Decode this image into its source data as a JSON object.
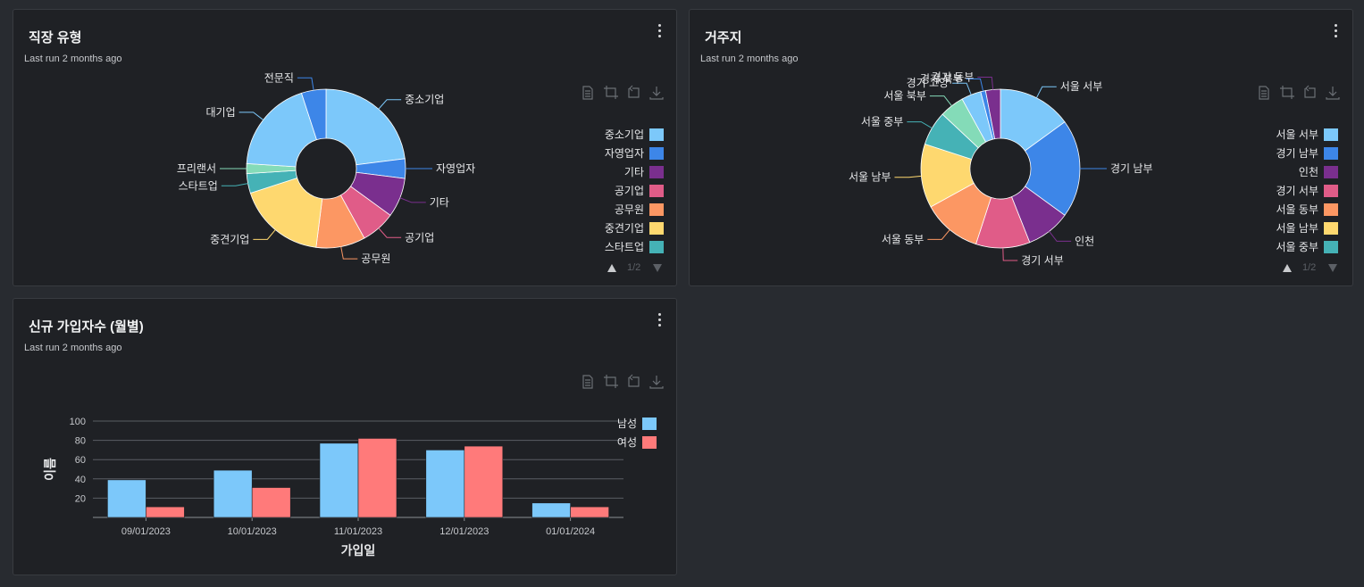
{
  "colors": {
    "background": "#282b30",
    "panel": "#1f2125",
    "light_blue": "#7cc8fa",
    "blue": "#3d86e8",
    "purple": "#7a2f8e",
    "pink": "#e05c88",
    "orange": "#fc9763",
    "yellow": "#fed86f",
    "teal": "#45b2b6",
    "mint": "#84dbb8",
    "salmon": "#ff7a7a"
  },
  "panels": [
    {
      "title": "직장 유형",
      "subtitle": "Last run 2 months ago",
      "pager": "1/2",
      "toolbox_icons": [
        "data-view-icon",
        "zoom-icon",
        "zoom-reset-icon",
        "download-icon"
      ],
      "chart_data": {
        "type": "pie",
        "title": "",
        "slices": [
          {
            "name": "중소기업",
            "value": 23,
            "color": "#7cc8fa"
          },
          {
            "name": "자영업자",
            "value": 4,
            "color": "#3d86e8"
          },
          {
            "name": "기타",
            "value": 8,
            "color": "#7a2f8e"
          },
          {
            "name": "공기업",
            "value": 7,
            "color": "#e05c88"
          },
          {
            "name": "공무원",
            "value": 10,
            "color": "#fc9763"
          },
          {
            "name": "중견기업",
            "value": 18,
            "color": "#fed86f"
          },
          {
            "name": "스타트업",
            "value": 4,
            "color": "#45b2b6"
          },
          {
            "name": "프리랜서",
            "value": 2,
            "color": "#84dbb8"
          },
          {
            "name": "대기업",
            "value": 19,
            "color": "#7cc8fa"
          },
          {
            "name": "전문직",
            "value": 5,
            "color": "#3d86e8"
          }
        ],
        "legend": {
          "placement": "right",
          "entries": [
            "중소기업",
            "자영업자",
            "기타",
            "공기업",
            "공무원",
            "중견기업",
            "스타트업"
          ]
        }
      }
    },
    {
      "title": "거주지",
      "subtitle": "Last run 2 months ago",
      "pager": "1/2",
      "toolbox_icons": [
        "data-view-icon",
        "zoom-icon",
        "zoom-reset-icon",
        "download-icon"
      ],
      "chart_data": {
        "type": "pie",
        "title": "",
        "slices": [
          {
            "name": "서울 서부",
            "value": 15,
            "color": "#7cc8fa"
          },
          {
            "name": "경기 남부",
            "value": 20,
            "color": "#3d86e8"
          },
          {
            "name": "인천",
            "value": 9,
            "color": "#7a2f8e"
          },
          {
            "name": "경기 서부",
            "value": 11,
            "color": "#e05c88"
          },
          {
            "name": "서울 동부",
            "value": 12,
            "color": "#fc9763"
          },
          {
            "name": "서울 남부",
            "value": 13,
            "color": "#fed86f"
          },
          {
            "name": "서울 중부",
            "value": 7,
            "color": "#45b2b6"
          },
          {
            "name": "서울 북부",
            "value": 5,
            "color": "#84dbb8"
          },
          {
            "name": "경기 고양",
            "value": 4,
            "color": "#7cc8fa"
          },
          {
            "name": "경기 북부",
            "value": 1,
            "color": "#3d86e8"
          },
          {
            "name": "경기 동부",
            "value": 3,
            "color": "#7a2f8e"
          }
        ],
        "legend": {
          "placement": "right",
          "entries": [
            "서울 서부",
            "경기 남부",
            "인천",
            "경기 서부",
            "서울 동부",
            "서울 남부",
            "서울 중부"
          ]
        }
      }
    },
    {
      "title": "신규 가입자수 (월별)",
      "subtitle": "Last run 2 months ago",
      "toolbox_icons": [
        "data-view-icon",
        "zoom-icon",
        "zoom-reset-icon",
        "download-icon"
      ],
      "chart_data": {
        "type": "bar",
        "title": "",
        "categories": [
          "09/01/2023",
          "10/01/2023",
          "11/01/2023",
          "12/01/2023",
          "01/01/2024"
        ],
        "series": [
          {
            "name": "남성",
            "values": [
              39,
              49,
              77,
              70,
              15
            ],
            "color": "#7cc8fa"
          },
          {
            "name": "여성",
            "values": [
              11,
              31,
              82,
              74,
              11
            ],
            "color": "#ff7a7a"
          }
        ],
        "xlabel": "가입일",
        "ylabel": "이름",
        "ylim": [
          0,
          100
        ],
        "yticks": [
          20,
          40,
          60,
          80,
          100
        ],
        "grid": true,
        "legend": {
          "placement": "top-right"
        }
      }
    }
  ]
}
